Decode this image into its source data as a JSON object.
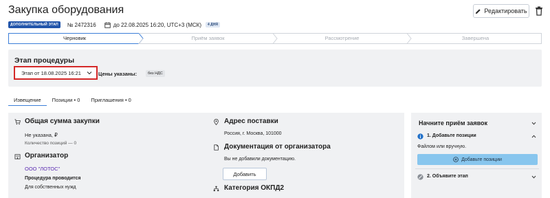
{
  "header": {
    "title": "Закупка оборудования",
    "edit_label": "Редактировать",
    "stage_badge": "ДОПОЛНИТЕЛЬНЫЙ ЭТАП",
    "number": "№ 2472316",
    "deadline": "до 22.08.2025 16:20, UTC+3 (МСК)",
    "days_badge": "4 ДНЯ"
  },
  "steps": [
    {
      "label": "Черновик",
      "active": true
    },
    {
      "label": "Приём заявок",
      "active": false
    },
    {
      "label": "Рассмотрение",
      "active": false
    },
    {
      "label": "Завершена",
      "active": false
    }
  ],
  "stage": {
    "title": "Этап процедуры",
    "selected": "Этап от 18.08.2025 16:21",
    "prices_label": "Цены указаны:",
    "vat_badge": "без НДС"
  },
  "tabs": [
    "Извещение",
    "Позиции • 0",
    "Приглашения • 0"
  ],
  "details": {
    "sum_title": "Общая сумма закупки",
    "sum_value": "Не указана, ₽",
    "positions_count": "Количество позиций — 0",
    "organizer_title": "Организатор",
    "organizer_name": "ООО \"ЛОТОС\"",
    "procedure_label": "Процедура проводится",
    "procedure_value": "Для собственных нужд",
    "address_title": "Адрес поставки",
    "address_value": "Россия, г. Москва, 101000",
    "docs_title": "Документация от организатора",
    "docs_value": "Вы не добавили документацию.",
    "add_label": "Добавить",
    "okpd_title": "Категория ОКПД2"
  },
  "sidebar": {
    "title": "Начните приём заявок",
    "step1": "1. Добавьте позиции",
    "step1_desc": "Файлом или вручную.",
    "add_positions": "Добавьте позиции",
    "step2": "2. Объявите этап"
  },
  "colors": {
    "accent": "#3b7ed8",
    "badge_blue": "#2255aa",
    "highlight_red": "#d42828",
    "button_light_blue": "#88c6ee",
    "organizer_purple": "#5a2bb0"
  }
}
